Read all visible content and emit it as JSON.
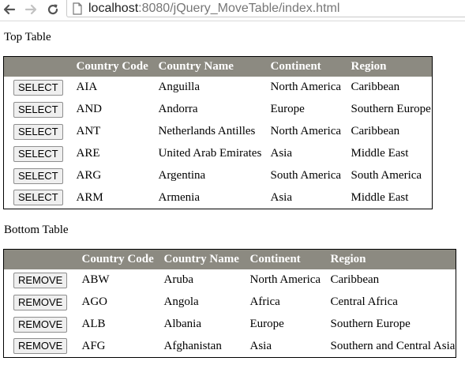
{
  "browser": {
    "url_host": "localhost",
    "url_rest": ":8080/jQuery_MoveTable/index.html"
  },
  "top_section": {
    "title": "Top Table",
    "button_label": "SELECT",
    "headers": [
      "Country Code",
      "Country Name",
      "Continent",
      "Region"
    ],
    "rows": [
      {
        "code": "AIA",
        "name": "Anguilla",
        "continent": "North America",
        "region": "Caribbean"
      },
      {
        "code": "AND",
        "name": "Andorra",
        "continent": "Europe",
        "region": "Southern Europe"
      },
      {
        "code": "ANT",
        "name": "Netherlands Antilles",
        "continent": "North America",
        "region": "Caribbean"
      },
      {
        "code": "ARE",
        "name": "United Arab Emirates",
        "continent": "Asia",
        "region": "Middle East"
      },
      {
        "code": "ARG",
        "name": "Argentina",
        "continent": "South America",
        "region": "South America"
      },
      {
        "code": "ARM",
        "name": "Armenia",
        "continent": "Asia",
        "region": "Middle East"
      }
    ]
  },
  "bottom_section": {
    "title": "Bottom Table",
    "button_label": "REMOVE",
    "headers": [
      "Country Code",
      "Country Name",
      "Continent",
      "Region"
    ],
    "rows": [
      {
        "code": "ABW",
        "name": "Aruba",
        "continent": "North America",
        "region": "Caribbean"
      },
      {
        "code": "AGO",
        "name": "Angola",
        "continent": "Africa",
        "region": "Central Africa"
      },
      {
        "code": "ALB",
        "name": "Albania",
        "continent": "Europe",
        "region": "Southern Europe"
      },
      {
        "code": "AFG",
        "name": "Afghanistan",
        "continent": "Asia",
        "region": "Southern and Central Asia"
      }
    ]
  },
  "icons": {
    "back": "arrow-left-icon",
    "forward": "arrow-right-icon",
    "reload": "reload-icon",
    "page": "page-icon"
  },
  "colors": {
    "header_bg": "#8c8a81",
    "header_text": "#ffffff"
  }
}
